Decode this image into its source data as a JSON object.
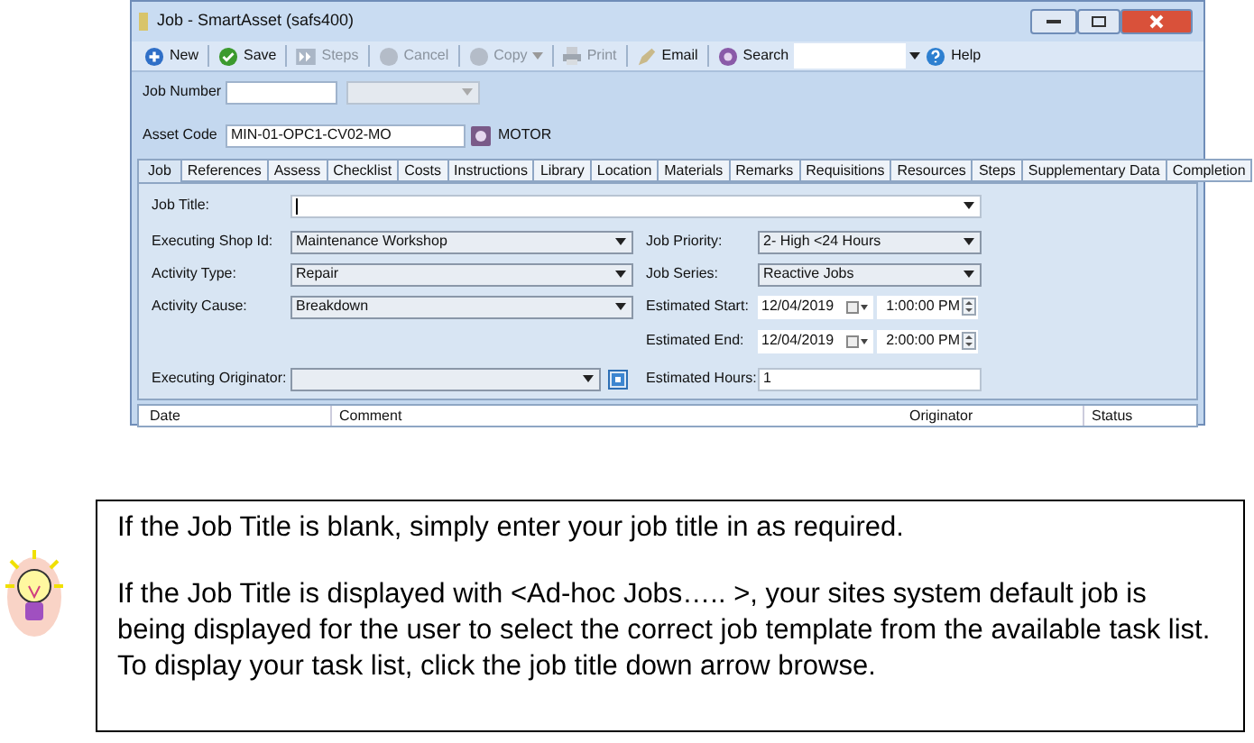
{
  "window": {
    "title": "Job - SmartAsset (safs400)"
  },
  "toolbar": [
    {
      "kind": "button",
      "label": "New",
      "disabled": false
    },
    {
      "kind": "button",
      "label": "Save",
      "disabled": false
    },
    {
      "kind": "button",
      "label": "Steps",
      "disabled": true
    },
    {
      "kind": "button",
      "label": "Cancel",
      "disabled": true
    },
    {
      "kind": "dropdown",
      "label": "Copy",
      "disabled": true
    },
    {
      "kind": "button",
      "label": "Print",
      "disabled": true
    },
    {
      "kind": "button",
      "label": "Email",
      "disabled": false
    },
    {
      "kind": "button",
      "label": "Search",
      "disabled": false
    },
    {
      "kind": "field"
    },
    {
      "kind": "button",
      "label": "Help",
      "disabled": false
    }
  ],
  "job_number": {
    "label": "Job Number"
  },
  "asset_code": {
    "label": "Asset Code",
    "value": "MIN-01-OPC1-CV02-MO",
    "description": "MOTOR"
  },
  "tabs": [
    {
      "label": "Job",
      "selected": true
    },
    {
      "label": "References",
      "selected": false
    },
    {
      "label": "Assess",
      "selected": false
    },
    {
      "label": "Checklist",
      "selected": false
    },
    {
      "label": "Costs",
      "selected": false
    },
    {
      "label": "Instructions",
      "selected": false
    },
    {
      "label": "Library",
      "selected": false
    },
    {
      "label": "Location",
      "selected": false
    },
    {
      "label": "Materials",
      "selected": false
    },
    {
      "label": "Remarks",
      "selected": false
    },
    {
      "label": "Requisitions",
      "selected": false
    },
    {
      "label": "Resources",
      "selected": false
    },
    {
      "label": "Steps",
      "selected": false
    },
    {
      "label": "Supplementary Data",
      "selected": false
    },
    {
      "label": "Completion",
      "selected": false
    }
  ],
  "job_title": {
    "label": "Job Title:"
  },
  "form_rows": [
    {
      "left": {
        "kind": "combo",
        "label": "Executing Shop Id:",
        "value": "Maintenance Workshop"
      },
      "right": {
        "kind": "combo",
        "label": "Job Priority:",
        "value": "2- High <24 Hours"
      }
    },
    {
      "left": {
        "kind": "combo",
        "label": "Activity Type:",
        "value": "Repair"
      },
      "right": {
        "kind": "combo",
        "label": "Job Series:",
        "value": "Reactive Jobs"
      }
    },
    {
      "left": {
        "kind": "combo",
        "label": "Activity Cause:",
        "value": "Breakdown"
      },
      "right": {
        "kind": "datetime",
        "label": "Estimated Start:",
        "date": "12/04/2019",
        "time": "1:00:00 PM"
      }
    },
    {
      "right": {
        "kind": "datetime",
        "label": "Estimated End:",
        "date": "12/04/2019",
        "time": "2:00:00 PM"
      }
    },
    {
      "left": {
        "kind": "combo_browse",
        "label": "Executing Originator:"
      },
      "right": {
        "kind": "text",
        "label": "Estimated Hours:",
        "value": "1"
      }
    }
  ],
  "grid": {
    "columns": [
      "Date",
      "Comment",
      "Originator",
      "Status"
    ]
  },
  "note": {
    "paragraphs": [
      "If the Job Title is blank, simply enter your job title in as required.",
      "If the Job Title is displayed with <Ad-hoc Jobs….. >, your sites system default job is being displayed for the user to select the correct job template from the available task list. To display your task list, click the job title down arrow browse."
    ]
  }
}
